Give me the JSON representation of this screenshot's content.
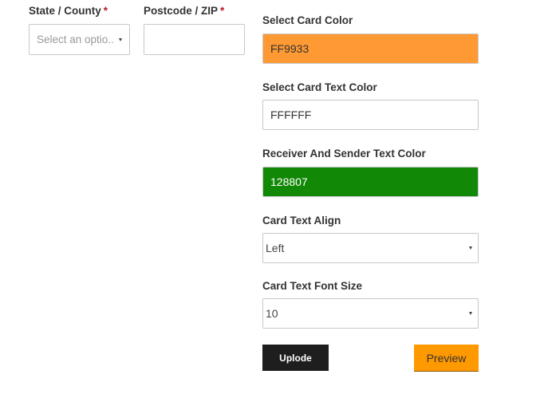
{
  "address": {
    "state_label": "State / County",
    "state_required_mark": "*",
    "state_placeholder": "Select an optio..",
    "postcode_label": "Postcode / ZIP",
    "postcode_required_mark": "*",
    "postcode_value": ""
  },
  "card": {
    "card_color_label": "Select Card Color",
    "card_color_value": "FF9933",
    "card_color_hex": "#ff9933",
    "card_text_color_label": "Select Card Text Color",
    "card_text_color_value": "FFFFFF",
    "card_text_color_hex": "#ffffff",
    "receiver_sender_color_label": "Receiver And Sender Text Color",
    "receiver_sender_color_value": "128807",
    "receiver_sender_color_hex": "#128807",
    "text_align_label": "Card Text Align",
    "text_align_value": "Left",
    "font_size_label": "Card Text Font Size",
    "font_size_value": "10"
  },
  "actions": {
    "upload_label": "Uplode",
    "preview_label": "Preview"
  },
  "colors": {
    "upload_button_bg": "#1e1e1e",
    "preview_button_bg": "#ff9900",
    "required_mark": "#b81c23"
  }
}
